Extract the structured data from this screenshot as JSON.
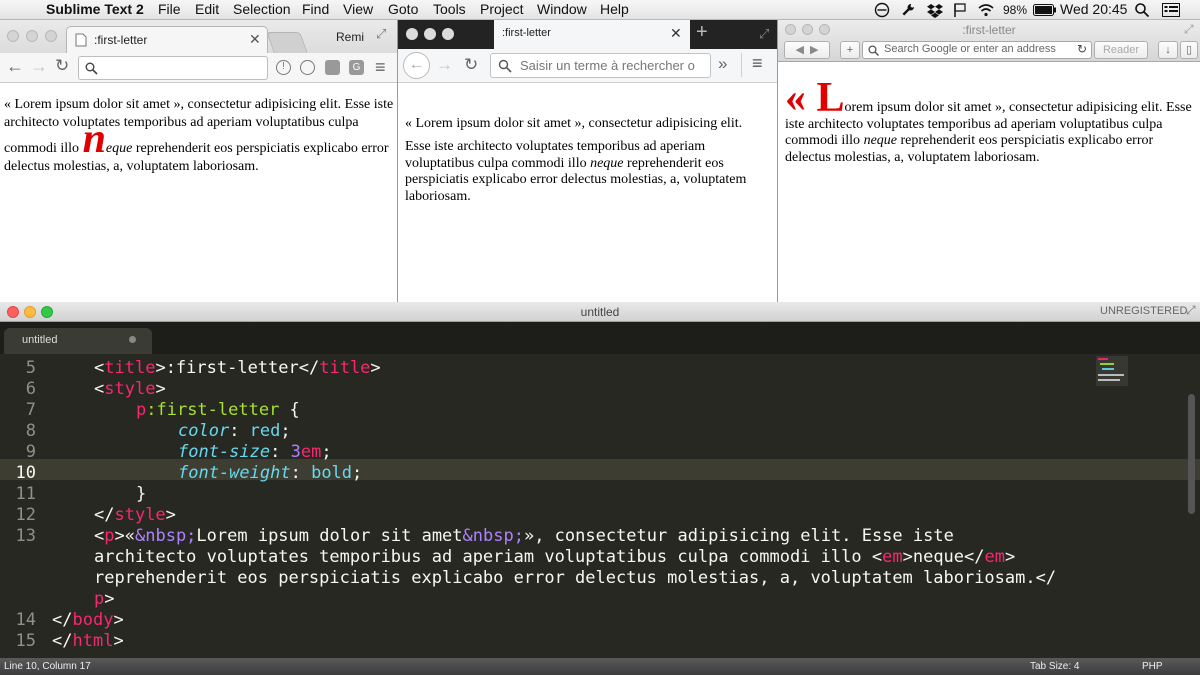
{
  "menubar": {
    "app_name": "Sublime Text 2",
    "items": [
      "File",
      "Edit",
      "Selection",
      "Find",
      "View",
      "Goto",
      "Tools",
      "Project",
      "Window",
      "Help"
    ],
    "battery": "98%",
    "clock": "Wed 20:45"
  },
  "chrome": {
    "tab_title": ":first-letter",
    "profile": "Remi",
    "address_value": "",
    "para_prefix": "« Lorem ipsum dolor sit amet », consectetur adipisicing elit. Esse iste architecto voluptates temporibus ad aperiam voluptatibus culpa commodi illo ",
    "para_first_letter": "n",
    "para_em_rest": "eque",
    "para_suffix": " reprehenderit eos perspiciatis explicabo error delectus molestias, a, voluptatem laboriosam."
  },
  "firefox": {
    "tab_title": ":first-letter",
    "search_placeholder": "Saisir un terme à rechercher o",
    "para_line1": "« Lorem ipsum dolor sit amet », consectetur adipisicing elit.",
    "para_prefix": "Esse iste architecto voluptates temporibus ad aperiam voluptatibus culpa commodi illo ",
    "para_em": "neque",
    "para_suffix": " reprehenderit eos perspiciatis explicabo error delectus molestias, a, voluptatem laboriosam."
  },
  "safari": {
    "window_title": ":first-letter",
    "address_placeholder": "Search Google or enter an address",
    "reader_label": "Reader",
    "first_letter": "« L",
    "para_rest": "orem ipsum dolor sit amet », consectetur adipisicing elit. Esse iste architecto voluptates temporibus ad aperiam voluptatibus culpa commodi illo ",
    "para_em": "neque",
    "para_suffix": " reprehenderit eos perspiciatis explicabo error delectus molestias, a, voluptatem laboriosam."
  },
  "sublime": {
    "window_title": "untitled",
    "registration": "UNREGISTERED",
    "tab_label": "untitled",
    "line_numbers": [
      "5",
      "6",
      "7",
      "8",
      "9",
      "10",
      "11",
      "12",
      "13",
      "14",
      "15"
    ],
    "code": {
      "l5_open": "<",
      "l5_tag": "title",
      "l5_mid1": ">",
      "l5_text": ":first-letter",
      "l5_close_open": "</",
      "l5_tag2": "title",
      "l5_end": ">",
      "l6_open": "<",
      "l6_tag": "style",
      "l6_end": ">",
      "l7_sel": "p:first-letter",
      "l7_brace": " {",
      "l8_prop": "color",
      "l8_colon": ": ",
      "l8_val": "red",
      "l8_semi": ";",
      "l9_prop": "font-size",
      "l9_colon": ": ",
      "l9_num": "3",
      "l9_unit": "em",
      "l9_semi": ";",
      "l10_prop": "font-weight",
      "l10_colon": ": ",
      "l10_val": "bold",
      "l10_semi": ";",
      "l11": "}",
      "l12_open": "</",
      "l12_tag": "style",
      "l12_end": ">",
      "l13_open": "<",
      "l13_tag": "p",
      "l13_end": ">",
      "l13_q1": "«",
      "l13_ent1": "&nbsp;",
      "l13_text1": "Lorem ipsum dolor sit amet",
      "l13_ent2": "&nbsp;",
      "l13_text2": "», consectetur adipisicing elit. Esse iste",
      "l13_w2": "architecto voluptates temporibus ad aperiam voluptatibus culpa commodi illo ",
      "l13_em_open_lt": "<",
      "l13_em_tag": "em",
      "l13_em_open_gt": ">",
      "l13_em_text": "neque",
      "l13_em_close_lt": "</",
      "l13_em_tag2": "em",
      "l13_em_close_gt": ">",
      "l13_w3": "reprehenderit eos perspiciatis explicabo error delectus molestias, a, voluptatem laboriosam.</",
      "l13_w4_tag": "p",
      "l13_w4_end": ">",
      "l14_open": "</",
      "l14_tag": "body",
      "l14_end": ">",
      "l15_open": "</",
      "l15_tag": "html",
      "l15_end": ">"
    },
    "status_left": "Line 10, Column 17",
    "status_tabsize": "Tab Size: 4",
    "status_syntax": "PHP"
  },
  "colors": {
    "first_letter_red": "#e00000",
    "monokai_bg": "#272822",
    "monokai_tag": "#f92672",
    "monokai_attr": "#a6e22e",
    "monokai_prop": "#66d9ef",
    "monokai_num": "#ae81ff"
  }
}
